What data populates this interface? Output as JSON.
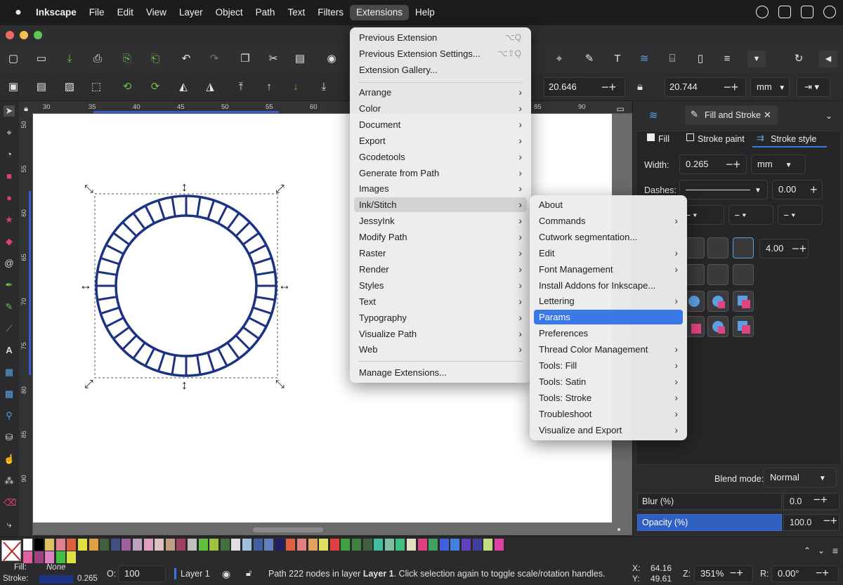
{
  "menubar": {
    "app": "Inkscape",
    "items": [
      "File",
      "Edit",
      "View",
      "Layer",
      "Object",
      "Path",
      "Text",
      "Filters",
      "Extensions",
      "Help"
    ]
  },
  "toolctrl": {
    "w_label": "W:",
    "w_value": "20.646",
    "h_label": "H:",
    "h_value": "20.744",
    "unit": "mm"
  },
  "ruler_h": [
    "30",
    "35",
    "40",
    "45",
    "50",
    "55",
    "60",
    "85",
    "90"
  ],
  "ruler_v": [
    "50",
    "55",
    "60",
    "65",
    "70",
    "75",
    "80",
    "85",
    "90"
  ],
  "extensions_menu": {
    "top": [
      {
        "label": "Previous Extension",
        "shortcut": "⌥Q"
      },
      {
        "label": "Previous Extension Settings...",
        "shortcut": "⌥⇧Q"
      },
      {
        "label": "Extension Gallery..."
      }
    ],
    "items": [
      "Arrange",
      "Color",
      "Document",
      "Export",
      "Gcodetools",
      "Generate from Path",
      "Images",
      "Ink/Stitch",
      "JessyInk",
      "Modify Path",
      "Raster",
      "Render",
      "Styles",
      "Text",
      "Typography",
      "Visualize Path",
      "Web"
    ],
    "manage": "Manage Extensions..."
  },
  "inkstitch_menu": {
    "items": [
      {
        "label": "About",
        "sub": false
      },
      {
        "label": "Commands",
        "sub": true
      },
      {
        "label": "Cutwork segmentation...",
        "sub": false
      },
      {
        "label": "Edit",
        "sub": true
      },
      {
        "label": "Font Management",
        "sub": true
      },
      {
        "label": "Install Addons for Inkscape...",
        "sub": false
      },
      {
        "label": "Lettering",
        "sub": true
      },
      {
        "label": "Params",
        "sub": false
      },
      {
        "label": "Preferences",
        "sub": false
      },
      {
        "label": "Thread Color Management",
        "sub": true
      },
      {
        "label": "Tools: Fill",
        "sub": true
      },
      {
        "label": "Tools: Satin",
        "sub": true
      },
      {
        "label": "Tools: Stroke",
        "sub": true
      },
      {
        "label": "Troubleshoot",
        "sub": true
      },
      {
        "label": "Visualize and Export",
        "sub": true
      }
    ],
    "selected": "Params"
  },
  "dock": {
    "tab_title": "Fill and Stroke",
    "tabs": [
      "Fill",
      "Stroke paint",
      "Stroke style"
    ],
    "width_label": "Width:",
    "width_value": "0.265",
    "width_unit": "mm",
    "dashes_label": "Dashes:",
    "dashes_value": "0.00",
    "miter_value": "4.00",
    "blend_label": "Blend mode:",
    "blend_value": "Normal",
    "blur_label": "Blur (%)",
    "blur_value": "0.0",
    "opacity_label": "Opacity (%)",
    "opacity_value": "100.0"
  },
  "palette_colors": [
    "#ffffff",
    "#000000",
    "#e0c060",
    "#e08090",
    "#e06040",
    "#e0e040",
    "#e0a040",
    "#406040",
    "#405080",
    "#a060a0",
    "#c0a0c0",
    "#e0a0c0",
    "#e0c0c0",
    "#c0a080",
    "#a04060",
    "#c0c0c0",
    "#60c040",
    "#a0c040",
    "#407040",
    "#e0e0e0",
    "#a0c0e0",
    "#4060a0",
    "#6080c0",
    "#202060",
    "#e06040",
    "#e08080",
    "#e0a060",
    "#e0e060",
    "#e04040",
    "#40a040",
    "#408040",
    "#406040",
    "#40c0a0",
    "#80c0a0",
    "#40c080",
    "#e0e0c0",
    "#e04080",
    "#40a060",
    "#4060e0",
    "#4080e0",
    "#6040c0",
    "#4040a0",
    "#c0e080",
    "#e040a0"
  ],
  "palette_row2": [
    "#e060a0",
    "#a04080",
    "#e080c0",
    "#40c040",
    "#e0e040"
  ],
  "statusbar": {
    "fill_label": "Fill:",
    "fill_value": "None",
    "stroke_label": "Stroke:",
    "stroke_width": "0.265",
    "o_label": "O:",
    "o_value": "100",
    "layer": "Layer 1",
    "message_pre": "Path 222 nodes in layer ",
    "message_layer": "Layer 1",
    "message_post": ". Click selection again to toggle scale/rotation handles.",
    "x_label": "X:",
    "x_value": "64.16",
    "y_label": "Y:",
    "y_value": "49.61",
    "z_label": "Z:",
    "z_value": "351%",
    "r_label": "R:",
    "r_value": "0.00°"
  },
  "colors": {
    "accent": "#3b78e7",
    "ring": "#1c3283"
  }
}
